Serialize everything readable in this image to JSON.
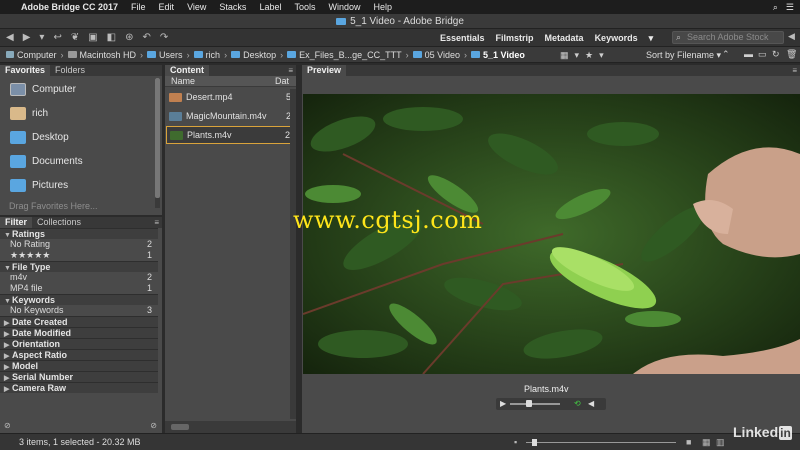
{
  "menubar": {
    "app_name": "Adobe Bridge CC 2017",
    "items": [
      "File",
      "Edit",
      "View",
      "Stacks",
      "Label",
      "Tools",
      "Window",
      "Help"
    ]
  },
  "window": {
    "title": "5_1 Video - Adobe Bridge"
  },
  "workspaces": [
    "Essentials",
    "Filmstrip",
    "Metadata",
    "Keywords"
  ],
  "search": {
    "placeholder": "Search Adobe Stock"
  },
  "path": [
    "Computer",
    "Macintosh HD",
    "Users",
    "rich",
    "Desktop",
    "Ex_Files_B...ge_CC_TTT",
    "05 Video",
    "5_1 Video"
  ],
  "sort": {
    "label": "Sort by Filename"
  },
  "favorites_panel": {
    "tabs": [
      "Favorites",
      "Folders"
    ],
    "items": [
      {
        "label": "Computer",
        "icon": "computer-icon"
      },
      {
        "label": "rich",
        "icon": "home-icon"
      },
      {
        "label": "Desktop",
        "icon": "folder-icon"
      },
      {
        "label": "Documents",
        "icon": "folder-icon"
      },
      {
        "label": "Pictures",
        "icon": "folder-icon"
      }
    ],
    "drag_hint": "Drag Favorites Here..."
  },
  "filter_panel": {
    "tabs": [
      "Filter",
      "Collections"
    ],
    "sections": [
      {
        "title": "Ratings",
        "expanded": true,
        "rows": [
          {
            "label": "No Rating",
            "count": "2"
          },
          {
            "label": "★★★★★",
            "count": "1"
          }
        ]
      },
      {
        "title": "File Type",
        "expanded": true,
        "rows": [
          {
            "label": "m4v",
            "count": "2"
          },
          {
            "label": "MP4 file",
            "count": "1"
          }
        ]
      },
      {
        "title": "Keywords",
        "expanded": true,
        "rows": [
          {
            "label": "No Keywords",
            "count": "3"
          }
        ]
      },
      {
        "title": "Date Created",
        "expanded": false,
        "rows": []
      },
      {
        "title": "Date Modified",
        "expanded": false,
        "rows": []
      },
      {
        "title": "Orientation",
        "expanded": false,
        "rows": []
      },
      {
        "title": "Aspect Ratio",
        "expanded": false,
        "rows": []
      },
      {
        "title": "Model",
        "expanded": false,
        "rows": []
      },
      {
        "title": "Serial Number",
        "expanded": false,
        "rows": []
      },
      {
        "title": "Camera Raw",
        "expanded": false,
        "rows": []
      }
    ]
  },
  "content_panel": {
    "tab": "Content",
    "columns": [
      "Name",
      "Dat"
    ],
    "files": [
      {
        "name": "Desert.mp4",
        "date": "5",
        "selected": false,
        "thumb": "#c08050"
      },
      {
        "name": "MagicMountain.m4v",
        "date": "2",
        "selected": false,
        "thumb": "#5a7e98"
      },
      {
        "name": "Plants.m4v",
        "date": "2",
        "selected": true,
        "thumb": "#3f6b2e"
      }
    ]
  },
  "preview_panel": {
    "tab": "Preview",
    "filename": "Plants.m4v"
  },
  "status": {
    "text": "3 items, 1 selected - 20.32 MB"
  },
  "watermark": "www.cgtsj.com",
  "brand": {
    "text": "Linked",
    "in": "in"
  },
  "colors": {
    "selection_border": "#d9a33b",
    "folder": "#5aa6e0",
    "watermark": "#ffe51a"
  }
}
